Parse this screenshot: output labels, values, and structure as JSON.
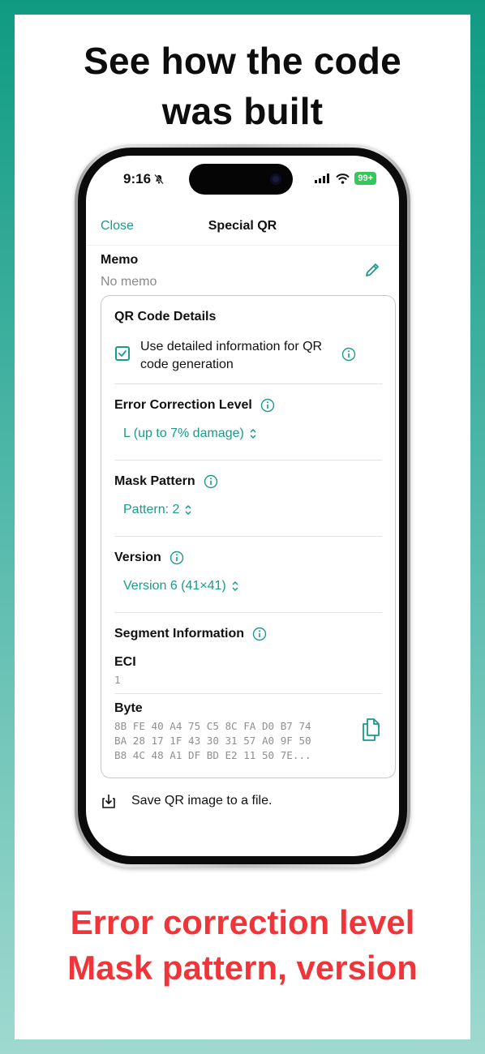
{
  "promo": {
    "headline_line1": "See how the code",
    "headline_line2": "was built",
    "footer_line1": "Error correction level",
    "footer_line2": "Mask pattern, version"
  },
  "status_bar": {
    "time": "9:16",
    "battery": "99+"
  },
  "nav": {
    "close_label": "Close",
    "title": "Special QR"
  },
  "memo": {
    "label": "Memo",
    "value": "No memo"
  },
  "details": {
    "title": "QR Code Details",
    "use_detailed_checked": true,
    "use_detailed_label": "Use detailed information for QR code generation",
    "error_correction": {
      "label": "Error Correction Level",
      "value": "L (up to 7% damage)"
    },
    "mask_pattern": {
      "label": "Mask Pattern",
      "value": "Pattern: 2"
    },
    "version": {
      "label": "Version",
      "value": "Version 6 (41×41)"
    },
    "segment": {
      "label": "Segment Information",
      "eci_label": "ECI",
      "eci_value": "1",
      "byte_label": "Byte",
      "byte_line1": "8B FE 40 A4 75 C5 8C FA D0 B7 74",
      "byte_line2": "BA 28 17 1F 43 30 31 57 A0 9F 50",
      "byte_line3": "B8 4C 48 A1 DF BD E2 11 50 7E..."
    }
  },
  "save": {
    "label": "Save QR image to a file."
  },
  "colors": {
    "accent": "#1a9a8a",
    "promo_red": "#f0353a",
    "battery_green": "#34c759"
  }
}
